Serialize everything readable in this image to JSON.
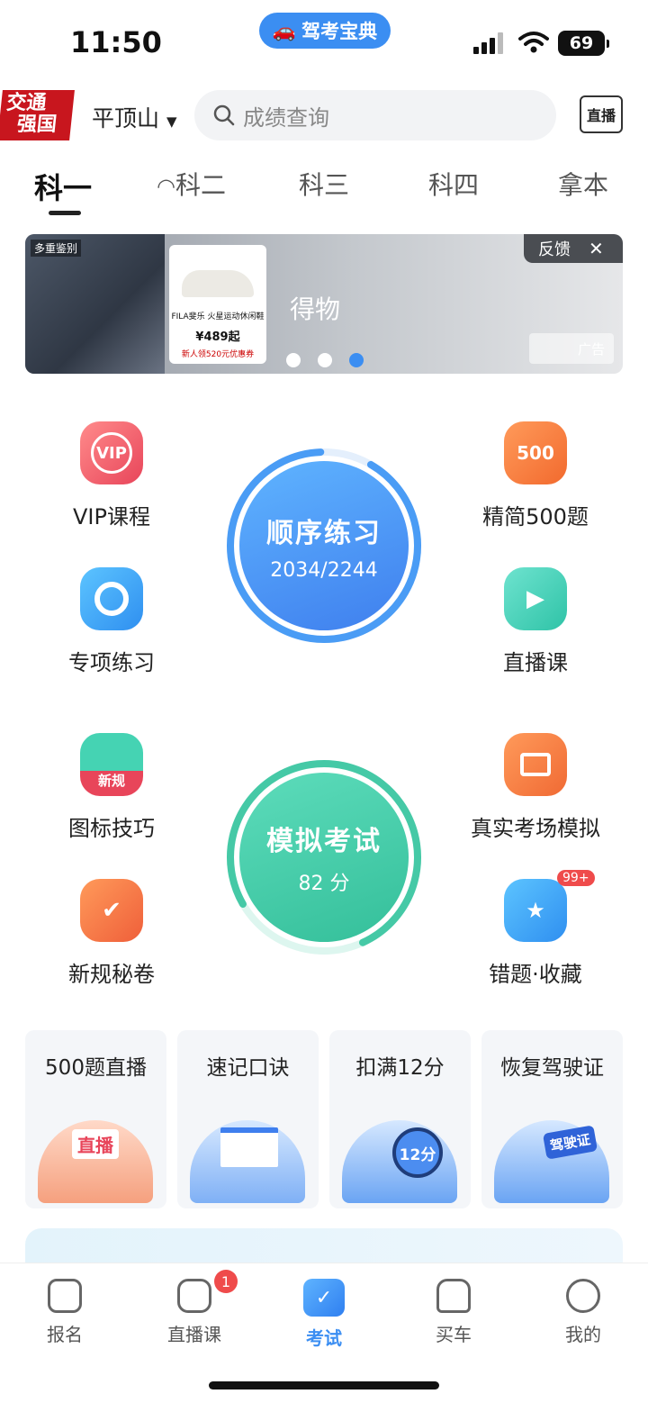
{
  "status": {
    "time": "11:50",
    "app_pill": "驾考宝典",
    "battery": "69"
  },
  "header": {
    "logo_line1": "交通",
    "logo_line2": "强国",
    "city": "平顶山",
    "search_placeholder": "成绩查询",
    "live_btn": "直播"
  },
  "tabs": [
    "科一",
    "科二",
    "科三",
    "科四",
    "拿本"
  ],
  "banner": {
    "brand": "得物",
    "tag": "多重鉴别",
    "feedback": "反馈",
    "ad_label": "广告",
    "product": "FILA斐乐 火星运动休闲鞋",
    "price": "¥489起",
    "coupon": "新人领520元优惠券",
    "dots_count": 3
  },
  "grid": {
    "vip": "VIP课程",
    "jingjian": "精简500题",
    "zhuanxiang": "专项练习",
    "zhibo": "直播课",
    "tubiao": "图标技巧",
    "zhenshi": "真实考场模拟",
    "xingui": "新规秘卷",
    "cuoti": "错题·收藏",
    "icon_500": "500",
    "icon_vip": "VIP",
    "icon_xingui": "新规",
    "cuoti_badge": "99+"
  },
  "practice": {
    "title": "顺序练习",
    "progress": "2034/2244"
  },
  "exam": {
    "title": "模拟考试",
    "score": "82 分"
  },
  "cards": [
    {
      "title": "500题直播",
      "art_text": "直播"
    },
    {
      "title": "速记口诀",
      "art_text": ""
    },
    {
      "title": "扣满12分",
      "art_text": "12分"
    },
    {
      "title": "恢复驾驶证",
      "art_text": "驾驶证"
    }
  ],
  "nav": {
    "baoming": "报名",
    "zhiboke": "直播课",
    "kaoshi": "考试",
    "maiche": "买车",
    "wode": "我的",
    "badge": "1"
  },
  "colors": {
    "accent": "#3b8ef2",
    "green": "#45c9a6",
    "red": "#c8161e"
  }
}
